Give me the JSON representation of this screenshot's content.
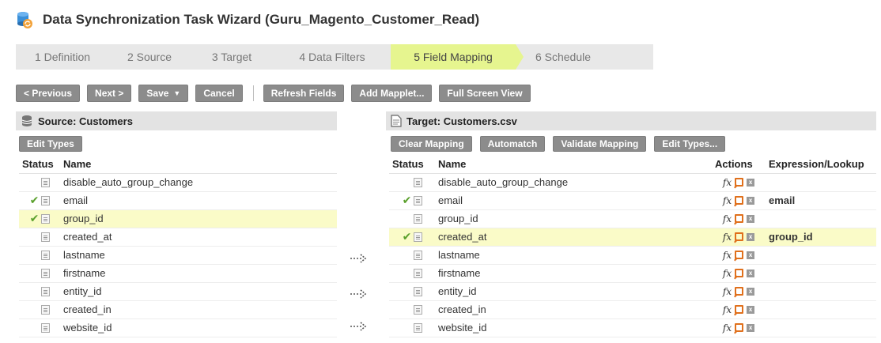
{
  "window": {
    "title": "Data Synchronization Task Wizard (Guru_Magento_Customer_Read)"
  },
  "steps": [
    {
      "label": "1 Definition"
    },
    {
      "label": "2 Source"
    },
    {
      "label": "3 Target"
    },
    {
      "label": "4 Data Filters"
    },
    {
      "label": "5 Field Mapping",
      "active": true
    },
    {
      "label": "6 Schedule"
    }
  ],
  "toolbar": {
    "previous": "< Previous",
    "next": "Next >",
    "save": "Save",
    "cancel": "Cancel",
    "refresh_fields": "Refresh Fields",
    "add_mapplet": "Add Mapplet...",
    "full_screen": "Full Screen View"
  },
  "source": {
    "header": "Source: Customers",
    "edit_types": "Edit Types",
    "col_status": "Status",
    "col_name": "Name",
    "rows": [
      {
        "name": "disable_auto_group_change",
        "mapped": false,
        "highlight": false
      },
      {
        "name": "email",
        "mapped": true,
        "highlight": false
      },
      {
        "name": "group_id",
        "mapped": true,
        "highlight": true
      },
      {
        "name": "created_at",
        "mapped": false,
        "highlight": false
      },
      {
        "name": "lastname",
        "mapped": false,
        "highlight": false
      },
      {
        "name": "firstname",
        "mapped": false,
        "highlight": false
      },
      {
        "name": "entity_id",
        "mapped": false,
        "highlight": false
      },
      {
        "name": "created_in",
        "mapped": false,
        "highlight": false
      },
      {
        "name": "website_id",
        "mapped": false,
        "highlight": false
      }
    ]
  },
  "target": {
    "header": "Target: Customers.csv",
    "clear_mapping": "Clear Mapping",
    "automatch": "Automatch",
    "validate_mapping": "Validate Mapping",
    "edit_types": "Edit Types...",
    "col_status": "Status",
    "col_name": "Name",
    "col_actions": "Actions",
    "col_expression": "Expression/Lookup",
    "fx_label": "fx",
    "rows": [
      {
        "name": "disable_auto_group_change",
        "mapped": false,
        "highlight": false,
        "expression": ""
      },
      {
        "name": "email",
        "mapped": true,
        "highlight": false,
        "expression": "email"
      },
      {
        "name": "group_id",
        "mapped": false,
        "highlight": false,
        "expression": ""
      },
      {
        "name": "created_at",
        "mapped": true,
        "highlight": true,
        "expression": "group_id"
      },
      {
        "name": "lastname",
        "mapped": false,
        "highlight": false,
        "expression": ""
      },
      {
        "name": "firstname",
        "mapped": false,
        "highlight": false,
        "expression": ""
      },
      {
        "name": "entity_id",
        "mapped": false,
        "highlight": false,
        "expression": ""
      },
      {
        "name": "created_in",
        "mapped": false,
        "highlight": false,
        "expression": ""
      },
      {
        "name": "website_id",
        "mapped": false,
        "highlight": false,
        "expression": ""
      }
    ]
  },
  "icons": {
    "check": "✔",
    "clear": "x"
  },
  "colors": {
    "active_step": "#e6f58f",
    "button": "#8c8c8c",
    "highlight_row": "#fafbc8",
    "check": "#5aa02c",
    "expression_link": "#2b7fd3"
  }
}
